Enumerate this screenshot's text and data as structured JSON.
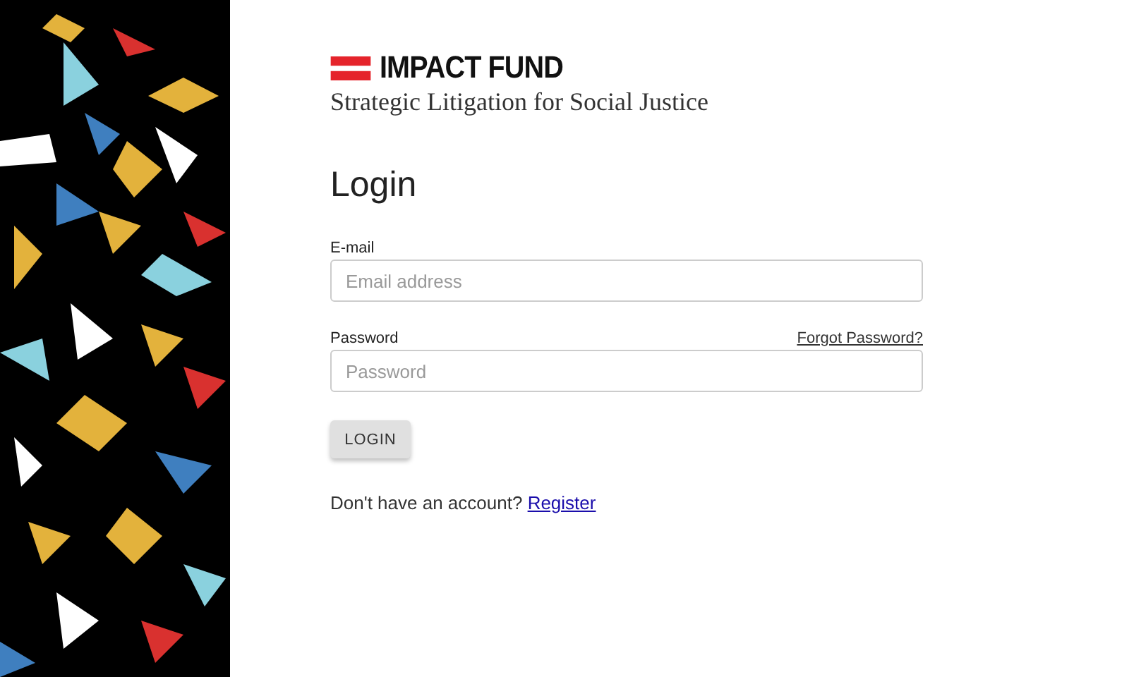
{
  "logo": {
    "name": "IMPACT FUND",
    "tagline": "Strategic Litigation for Social Justice"
  },
  "heading": "Login",
  "fields": [
    {
      "label": "E-mail",
      "placeholder": "Email address"
    },
    {
      "label": "Password",
      "placeholder": "Password",
      "link": "Forgot Password?"
    }
  ],
  "button": "LOGIN",
  "register": {
    "text": "Don't have an account?",
    "link": "Register"
  }
}
